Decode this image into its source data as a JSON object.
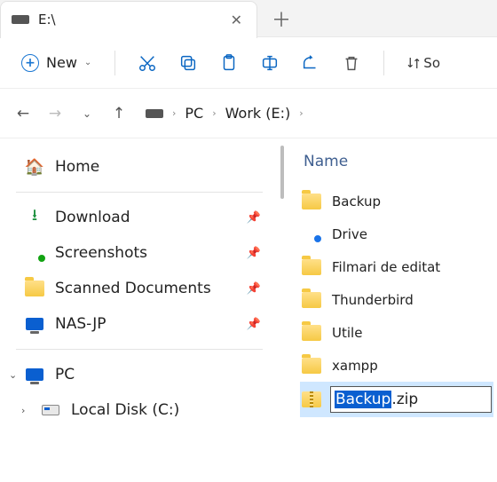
{
  "tab": {
    "title": "E:\\"
  },
  "toolbar": {
    "new_label": "New",
    "sort_fragment": "So"
  },
  "breadcrumb": {
    "pc": "PC",
    "drive": "Work (E:)"
  },
  "sidebar": {
    "home": "Home",
    "quick": [
      {
        "label": "Download"
      },
      {
        "label": "Screenshots"
      },
      {
        "label": "Scanned Documents"
      },
      {
        "label": "NAS-JP"
      }
    ],
    "pc": "PC",
    "local": "Local Disk (C:)"
  },
  "pane": {
    "header": "Name",
    "items": [
      {
        "label": "Backup"
      },
      {
        "label": "Drive"
      },
      {
        "label": "Filmari de editat"
      },
      {
        "label": "Thunderbird"
      },
      {
        "label": "Utile"
      },
      {
        "label": "xampp"
      }
    ],
    "rename": {
      "selected": "Backup",
      "rest": ".zip"
    }
  }
}
